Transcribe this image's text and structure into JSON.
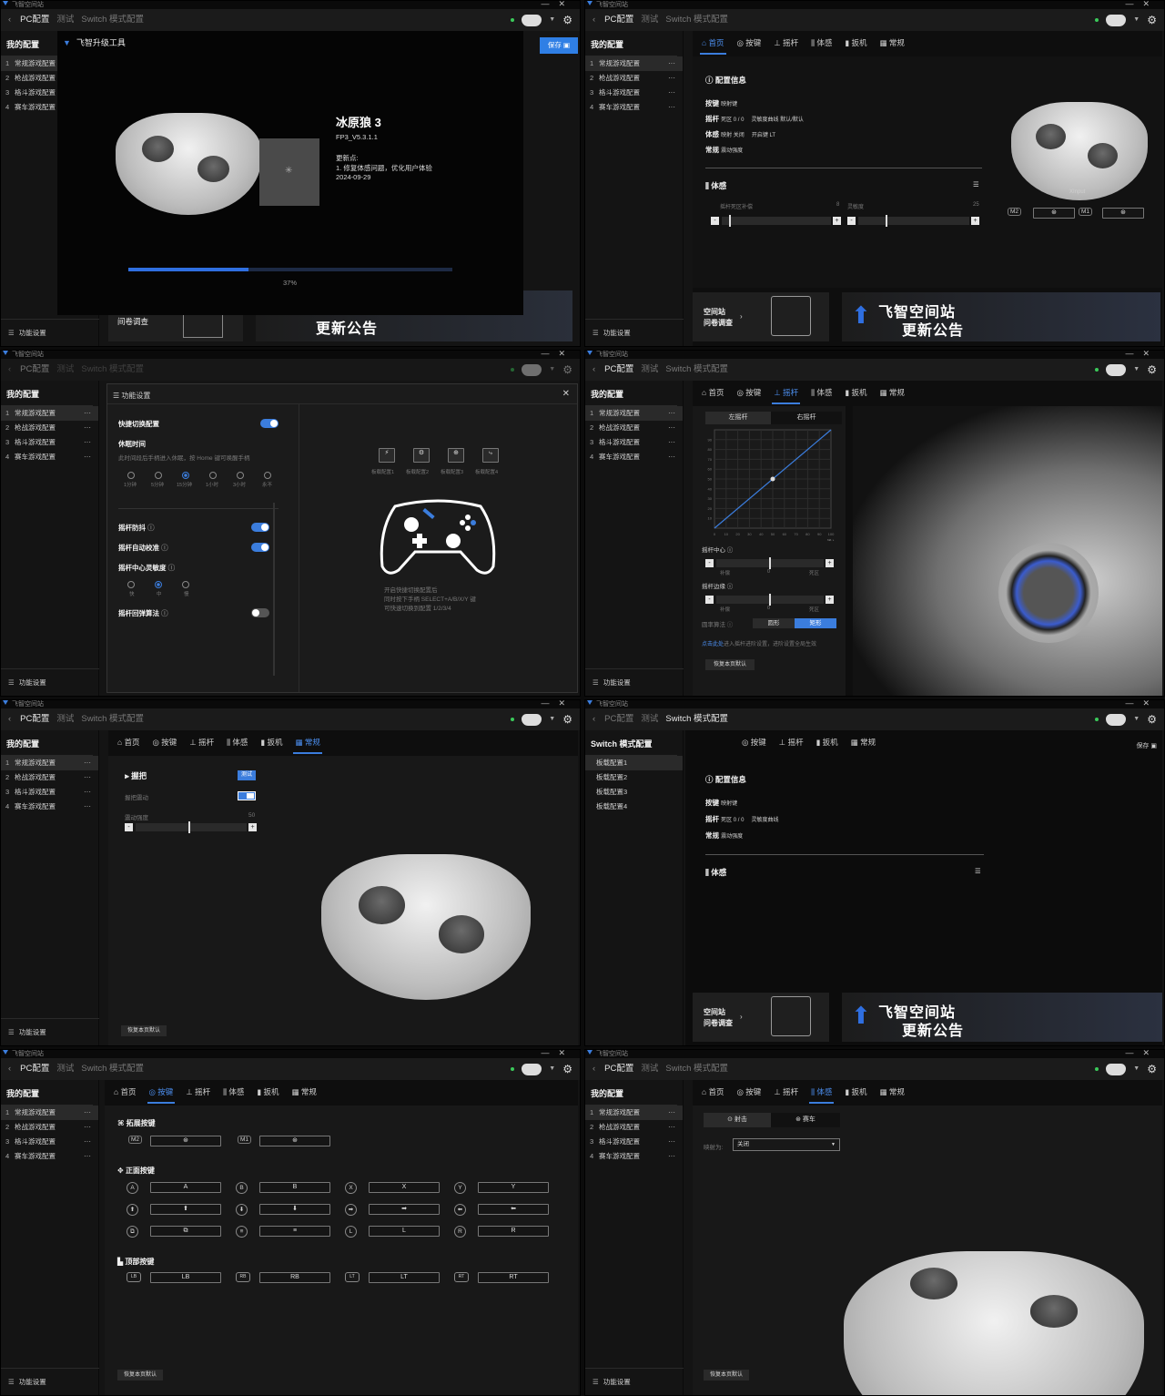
{
  "app": {
    "window_title": "飞智空间站",
    "pc_tab": "PC配置",
    "test_tab": "测试",
    "switch_tab": "Switch 模式配置",
    "back": "‹"
  },
  "sidebar": {
    "title": "我的配置",
    "items": [
      {
        "num": "1",
        "label": "常规游戏配置"
      },
      {
        "num": "2",
        "label": "枪战游戏配置"
      },
      {
        "num": "3",
        "label": "格斗游戏配置"
      },
      {
        "num": "4",
        "label": "赛车游戏配置"
      }
    ],
    "more": "···",
    "function_settings": "功能设置"
  },
  "nav": {
    "home": "首页",
    "keys": "按键",
    "stick": "摇杆",
    "motion": "体感",
    "trigger": "扳机",
    "general": "常规"
  },
  "panel1": {
    "tool_title": "飞智升级工具",
    "save": "保存",
    "device_name": "冰原狼 3",
    "firmware": "FP3_V5.3.1.1",
    "update_label": "更新点:",
    "update_note": "1. 修复体感问题，优化用户体验",
    "date": "2024-09-29",
    "progress_text": "37%",
    "progress": 0.37,
    "banner_left": "间卷调查",
    "banner_right": "更新公告"
  },
  "panel2": {
    "config_info": "配置信息",
    "rows": [
      {
        "k": "按键",
        "v1": "映射键",
        "v2": ""
      },
      {
        "k": "摇杆",
        "v1": "死区 0 / 0",
        "v2": "灵敏度曲线 默认/默认"
      },
      {
        "k": "体感",
        "v1": "映射 关闭",
        "v2": "开启键 LT"
      },
      {
        "k": "常规",
        "v1": "震动强度",
        "v2": ""
      }
    ],
    "motion": "体感",
    "deadzone": "摇杆死区补偿",
    "deadzone_val": "8",
    "sensitivity": "灵敏度",
    "sensitivity_val": "25",
    "xinput": "XInput",
    "m2": "M2",
    "m1": "M1",
    "banner_left1": "空间站",
    "banner_left2": "问卷调查",
    "banner_right1": "飞智空间站",
    "banner_right2": "更新公告"
  },
  "panel3": {
    "title": "功能设置",
    "close": "✕",
    "quick_switch": "快捷切换配置",
    "sleep": "休眠时间",
    "sleep_desc": "此时间段后手柄进入休眠，按 Home 键可唤醒手柄",
    "sleep_opts": [
      "1分钟",
      "5分钟",
      "15分钟",
      "1小时",
      "3小时",
      "永不"
    ],
    "anti_shake": "摇杆防抖",
    "auto_cal": "摇杆自动校准",
    "center_sens": "摇杆中心灵敏度",
    "center_opts": [
      "快",
      "中",
      "慢"
    ],
    "rebound": "摇杆回弹算法",
    "configs": [
      "板载配置1",
      "板载配置2",
      "板载配置3",
      "板载配置4"
    ],
    "hint1": "开启快捷切换配置后",
    "hint2": "同时按下手柄 SELECT+A/B/X/Y 键",
    "hint3": "可快速切换到配置 1/2/3/4"
  },
  "panel4": {
    "left_stick": "左摇杆",
    "right_stick": "右摇杆",
    "output": "输出",
    "input": "输入",
    "x_ticks": [
      "0",
      "10",
      "20",
      "30",
      "40",
      "50",
      "60",
      "70",
      "80",
      "90",
      "100"
    ],
    "y_ticks": [
      "90",
      "80",
      "70",
      "60",
      "50",
      "40",
      "30",
      "20",
      "10"
    ],
    "center": "摇杆中心",
    "edge": "摇杆边缘",
    "comp": "补偿",
    "deadzone": "死区",
    "zero": "0",
    "algo": "圆率算法",
    "round": "圆形",
    "square": "矩形",
    "link": "点击此处",
    "link_rest": "进入摇杆进阶设置，进阶设置全局生效",
    "reset": "恢复本页默认"
  },
  "panel5": {
    "grip": "握把",
    "test": "测试",
    "vibration": "握把震动",
    "strength": "震动强度",
    "strength_val": "50",
    "reset": "恢复本页默认"
  },
  "panel6": {
    "title": "Switch 模式配置",
    "configs": [
      "板载配置1",
      "板载配置2",
      "板载配置3",
      "板载配置4"
    ],
    "save": "保存",
    "config_info": "配置信息",
    "rows": [
      {
        "k": "按键",
        "v1": "映射键",
        "v2": ""
      },
      {
        "k": "摇杆",
        "v1": "死区 0 / 0",
        "v2": "灵敏度曲线"
      },
      {
        "k": "常规",
        "v1": "震动强度",
        "v2": ""
      }
    ],
    "motion": "体感"
  },
  "panel7": {
    "ext": "拓展按键",
    "face": "正面按键",
    "top": "顶部按键",
    "reset": "恢复本页默认",
    "m2": "M2",
    "m1": "M1",
    "face_rows": [
      [
        "A",
        "B",
        "X",
        "Y"
      ],
      [
        "⬆",
        "⬇",
        "➡",
        "⬅"
      ],
      [
        "⧉",
        "≡",
        "L",
        "R"
      ]
    ],
    "top_row": [
      "LB",
      "RB",
      "LT",
      "RT"
    ]
  },
  "panel8": {
    "shoot": "射击",
    "race": "赛车",
    "map_to": "映射为:",
    "map_val": "关闭",
    "reset": "恢复本页默认"
  }
}
